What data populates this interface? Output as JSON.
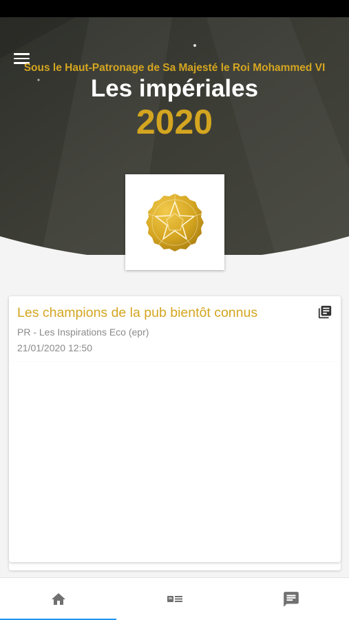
{
  "header": {
    "menu_icon": "hamburger-menu-icon",
    "patronage": "Sous le Haut-Patronage de Sa Majesté le Roi Mohammed VI",
    "title": "Les impériales",
    "year": "2020",
    "logo_icon": "golden-star-rosette-logo"
  },
  "article": {
    "title": "Les champions de la pub bientôt connus",
    "source": "PR - Les Inspirations Eco (epr)",
    "date": "21/01/2020 12:50",
    "icon": "library-books-icon"
  },
  "bottom_nav": {
    "items": [
      {
        "icon": "home-icon",
        "active": true
      },
      {
        "icon": "news-list-icon",
        "active": false
      },
      {
        "icon": "chat-message-icon",
        "active": false
      }
    ],
    "active_color": "#2196f3"
  },
  "colors": {
    "gold": "#d4a520",
    "hero_dark": "#3a3b34",
    "background": "#f4f4f4"
  }
}
